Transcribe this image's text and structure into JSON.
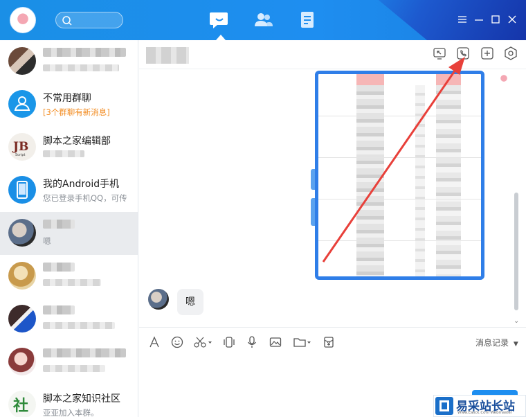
{
  "colors": {
    "topbar": "#1e8ef0",
    "accent": "#2f7ee8",
    "annotation_arrow": "#e8403a",
    "unread_notice": "#f28a1e"
  },
  "nav": {
    "icons": [
      "message-icon",
      "contacts-icon",
      "space-icon"
    ],
    "active": "message-icon"
  },
  "sidebar": {
    "items": [
      {
        "name": "",
        "preview": "",
        "avatar": "avatar-photo",
        "blurred": true
      },
      {
        "name": "不常用群聊",
        "preview": "[3个群聊有新消息]",
        "avatar": "group-folder-icon",
        "blurred": false
      },
      {
        "name": "脚本之家编辑部",
        "preview": "",
        "avatar": "jb-logo",
        "blurred": false
      },
      {
        "name": "我的Android手机",
        "preview": "您已登录手机QQ，可传",
        "avatar": "phone-icon",
        "blurred": false
      },
      {
        "name": "",
        "preview": "嗯",
        "avatar": "avatar-photo",
        "blurred": true,
        "active": true
      },
      {
        "name": "",
        "preview": "",
        "avatar": "avatar-photo",
        "blurred": true
      },
      {
        "name": "",
        "preview": "",
        "avatar": "avatar-photo",
        "blurred": true
      },
      {
        "name": "",
        "preview": "",
        "avatar": "avatar-photo",
        "blurred": true
      },
      {
        "name": "脚本之家知识社区",
        "preview": "亚亚加入本群。",
        "avatar": "community-logo",
        "blurred": false
      }
    ]
  },
  "chat_header": {
    "icons": [
      "screen-share-icon",
      "phone-call-icon",
      "add-member-icon",
      "more-hexagon-icon"
    ]
  },
  "messages": [
    {
      "from": "self",
      "type": "image"
    },
    {
      "from": "peer",
      "type": "text",
      "text": "嗯"
    }
  ],
  "toolbar": {
    "tools": [
      "font-icon",
      "emoji-icon",
      "scissors-icon",
      "shake-icon",
      "microphone-icon",
      "image-icon",
      "folder-icon",
      "red-packet-icon"
    ],
    "history_label": "消息记录"
  },
  "watermark": {
    "text": "易采站长站",
    "sub": "Www.Easck.Com Webmaster"
  }
}
